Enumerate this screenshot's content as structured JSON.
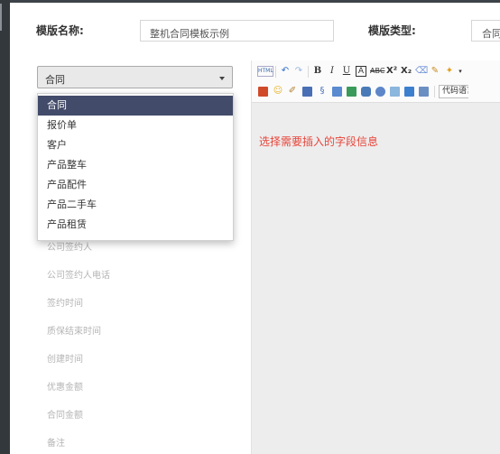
{
  "form": {
    "template_name_label": "模版名称:",
    "template_name_value": "整机合同模板示例",
    "template_type_label": "模版类型:",
    "template_type_value": "合同"
  },
  "field_select": {
    "selected": "合同",
    "options": [
      "合同",
      "报价单",
      "客户",
      "产品整车",
      "产品配件",
      "产品二手车",
      "产品租赁"
    ]
  },
  "field_list": [
    "公司签约人",
    "公司签约人电话",
    "签约时间",
    "质保结束时间",
    "创建时间",
    "优惠金额",
    "合同金额",
    "备注"
  ],
  "editor": {
    "hint": "选择需要插入的字段信息",
    "code_language_label": "代码语言",
    "toolbar_row1": [
      "html-source-icon",
      "undo-icon",
      "redo-icon",
      "bold-icon",
      "italic-icon",
      "underline-icon",
      "font-border-icon",
      "strikethrough-icon",
      "superscript-icon",
      "subscript-icon",
      "eraser-icon",
      "format-brush-icon",
      "forecolor-icon"
    ],
    "toolbar_row2": [
      "image-icon",
      "emoticon-icon",
      "scrawl-icon",
      "save-icon",
      "link-icon",
      "picture-icon",
      "gallery-icon",
      "video-icon",
      "map-icon",
      "template-icon",
      "background-icon",
      "attachment-icon"
    ]
  },
  "colors": {
    "active_option_bg": "#424b69",
    "hint_text": "#e8453a",
    "page_dark_bg": "#2f3337"
  }
}
